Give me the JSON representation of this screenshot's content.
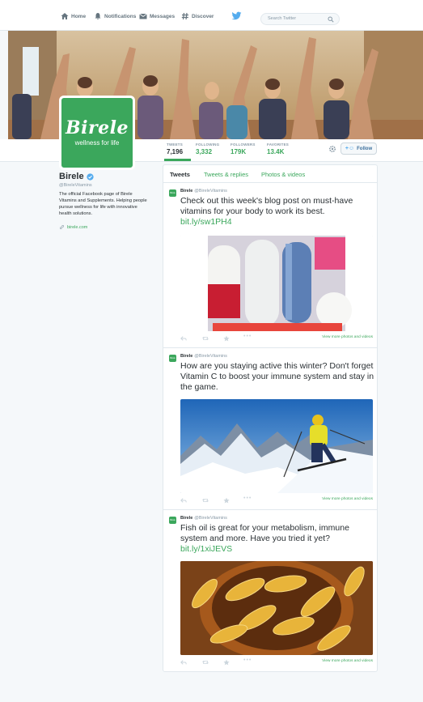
{
  "nav": {
    "home": "Home",
    "notifications": "Notifications",
    "messages": "Messages",
    "discover": "Discover",
    "search_placeholder": "Search Twitter"
  },
  "profile": {
    "avatar_name": "Birele",
    "avatar_tagline": "wellness for life",
    "name": "Birele",
    "handle": "@BireleVitamins",
    "bio": "The official Facebook page of Birele Vitamins and Supplements. Helping people pursue wellness for life with innovative health solutions.",
    "website": "birele.com"
  },
  "stats": [
    {
      "label": "TWEETS",
      "value": "7,196"
    },
    {
      "label": "FOLLOWING",
      "value": "3,332"
    },
    {
      "label": "FOLLOWERS",
      "value": "179K"
    },
    {
      "label": "FAVORITES",
      "value": "13.4K"
    }
  ],
  "follow_label": "Follow",
  "tabs": [
    "Tweets",
    "Tweets & replies",
    "Photos & videos"
  ],
  "tweets": [
    {
      "name": "Birele",
      "handle": "@BireleVitamins",
      "text": "Check out this week's blog post on must-have vitamins for your body to work its best.",
      "link": "bit.ly/sw1PH4",
      "view_more": "View more photos and videos"
    },
    {
      "name": "Birele",
      "handle": "@BireleVitamins",
      "text": "How are you staying active this winter? Don't forget Vitamin C to boost your immune system and stay in the game.",
      "link": "",
      "view_more": "View more photos and videos"
    },
    {
      "name": "Birele",
      "handle": "@BireleVitamins",
      "text": "Fish oil is great for your metabolism, immune system and more. Have you tried it yet?",
      "link": "bit.ly/1xiJEVS",
      "view_more": "View more photos and videos"
    }
  ],
  "colors": {
    "brand_green": "#3ba75c",
    "twitter_blue": "#55acee"
  }
}
